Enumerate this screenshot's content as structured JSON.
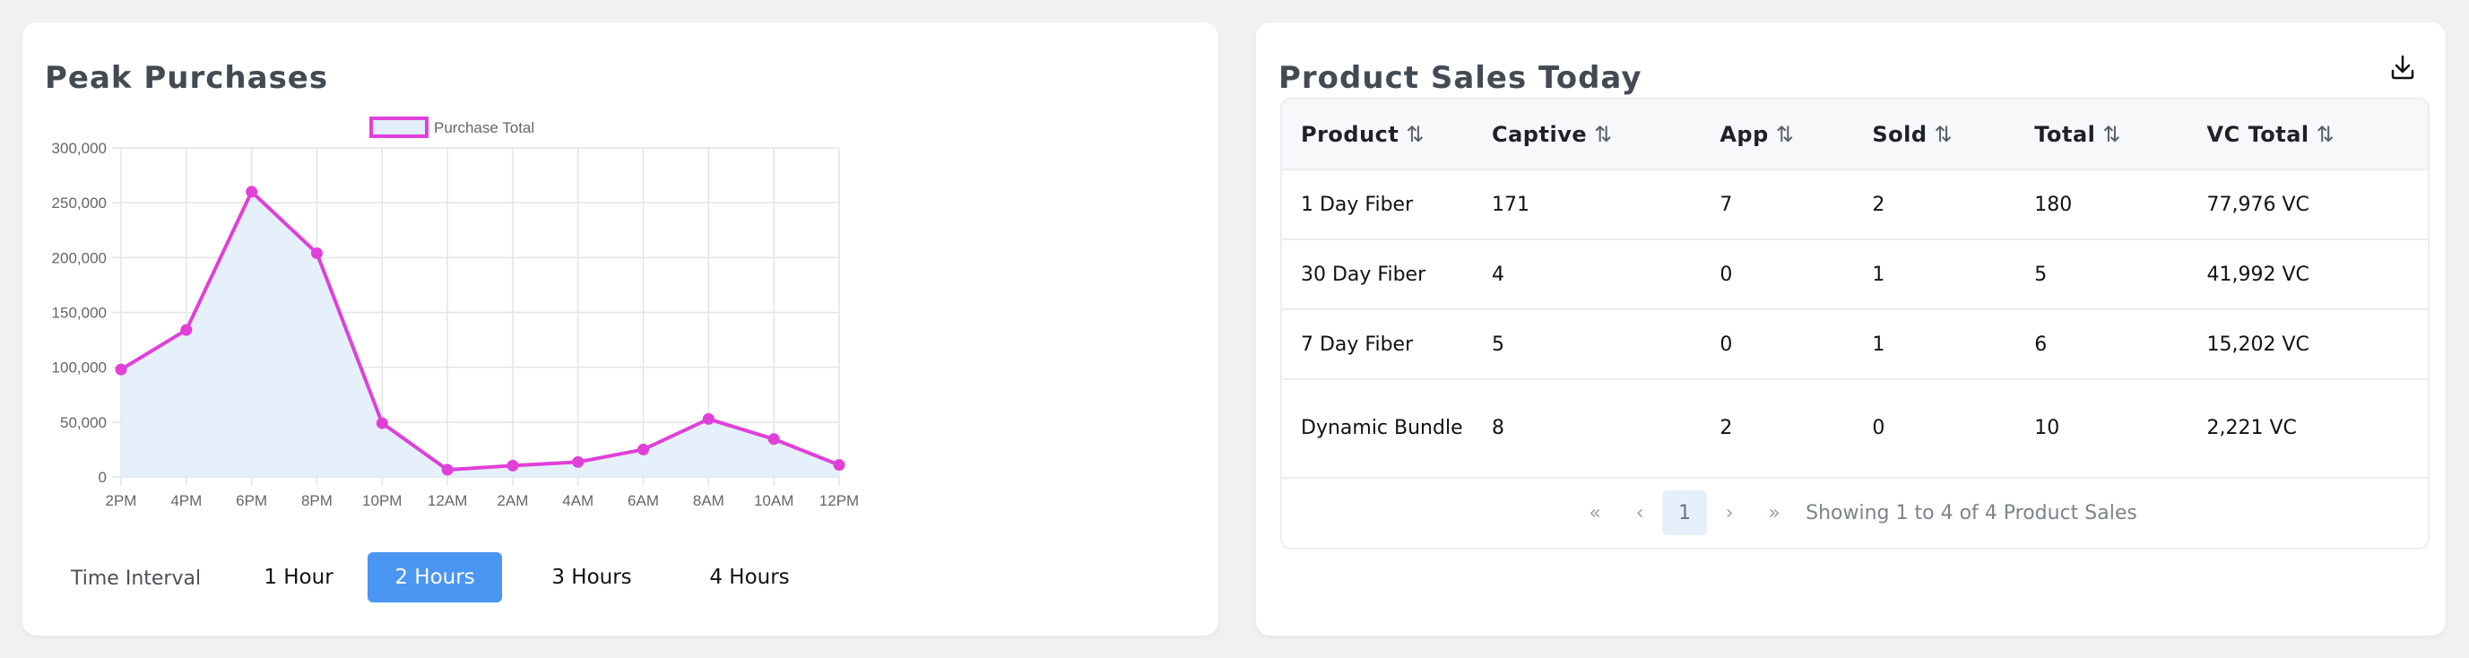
{
  "left_panel": {
    "title": "Peak Purchases",
    "interval_label": "Time Interval",
    "intervals": [
      {
        "label": "1 Hour",
        "active": false
      },
      {
        "label": "2 Hours",
        "active": true
      },
      {
        "label": "3 Hours",
        "active": false
      },
      {
        "label": "4 Hours",
        "active": false
      }
    ]
  },
  "chart_data": {
    "type": "area",
    "title": "",
    "xlabel": "",
    "ylabel": "",
    "legend": {
      "entries": [
        "Purchase Total"
      ],
      "placement": "top"
    },
    "x": [
      "2PM",
      "4PM",
      "6PM",
      "8PM",
      "10PM",
      "12AM",
      "2AM",
      "4AM",
      "6AM",
      "8AM",
      "10AM",
      "12PM"
    ],
    "series": [
      {
        "name": "Purchase Total",
        "values": [
          98000,
          134000,
          260000,
          204000,
          49000,
          6500,
          10300,
          13600,
          25000,
          52800,
          34500,
          10900
        ]
      }
    ],
    "ylim": [
      0,
      300000
    ],
    "yticks": [
      "0",
      "50,000",
      "100,000",
      "150,000",
      "200,000",
      "250,000",
      "300,000"
    ],
    "grid": true,
    "colors": {
      "line": "#e040d8",
      "fill": "#e2eefa"
    }
  },
  "right_panel": {
    "title": "Product Sales Today",
    "download_icon": "download-icon",
    "columns": [
      "Product",
      "Captive",
      "App",
      "Sold",
      "Total",
      "VC Total"
    ],
    "rows": [
      [
        "1 Day Fiber",
        "171",
        "7",
        "2",
        "180",
        "77,976 VC"
      ],
      [
        "30 Day Fiber",
        "4",
        "0",
        "1",
        "5",
        "41,992 VC"
      ],
      [
        "7 Day Fiber",
        "5",
        "0",
        "1",
        "6",
        "15,202 VC"
      ],
      [
        "Dynamic Bundle",
        "8",
        "2",
        "0",
        "10",
        "2,221 VC"
      ]
    ],
    "pagination": {
      "first": "«",
      "prev": "‹",
      "current": "1",
      "next": "›",
      "last": "»",
      "info": "Showing 1 to 4 of 4 Product Sales"
    }
  }
}
